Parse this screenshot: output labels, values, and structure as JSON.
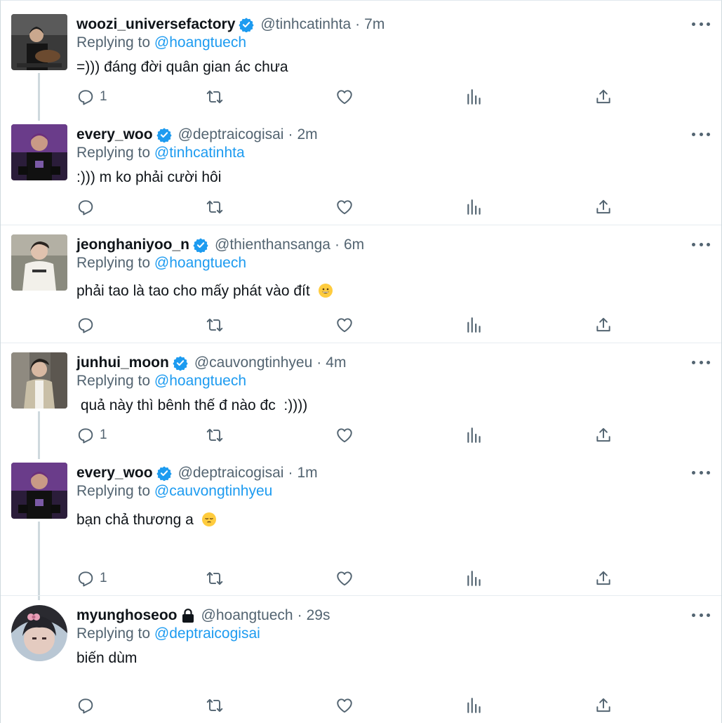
{
  "replying_label": "Replying to",
  "colors": {
    "accent": "#1d9bf0",
    "muted": "#536471",
    "text": "#0f1419",
    "verified": "#1d9bf0"
  },
  "icons": {
    "reply": "reply-icon",
    "retweet": "retweet-icon",
    "like": "heart-icon",
    "views": "analytics-icon",
    "share": "share-icon",
    "more": "more-icon",
    "verified": "verified-badge-icon",
    "lock": "lock-icon"
  },
  "tweets": [
    {
      "name": "woozi_universefactory",
      "verified": true,
      "handle": "@tinhcatinhta",
      "sep": "·",
      "time": "7m",
      "reply_to": "@hoangtuech",
      "text": "=))) đáng đời quân gian ác chưa",
      "reply_count": "1"
    },
    {
      "name": "every_woo",
      "verified": true,
      "handle": "@deptraicogisai",
      "sep": "·",
      "time": "2m",
      "reply_to": "@tinhcatinhta",
      "text": ":))) m ko phải cười hôi",
      "reply_count": ""
    },
    {
      "name": "jeonghaniyoo_n",
      "verified": true,
      "handle": "@thienthansanga",
      "sep": "·",
      "time": "6m",
      "reply_to": "@hoangtuech",
      "text": "phải tao là tao cho mấy phát vào đít",
      "emoji": "grinning-face",
      "reply_count": ""
    },
    {
      "name": "junhui_moon",
      "verified": true,
      "handle": "@cauvongtinhyeu",
      "sep": "·",
      "time": "4m",
      "reply_to": "@hoangtuech",
      "text": " quả này thì bênh thế đ nào đc  :))))",
      "reply_count": "1"
    },
    {
      "name": "every_woo",
      "verified": true,
      "handle": "@deptraicogisai",
      "sep": "·",
      "time": "1m",
      "reply_to": "@cauvongtinhyeu",
      "text": "bạn chả thương a",
      "emoji": "pensive-face",
      "reply_count": "1"
    },
    {
      "name": "myunghoseoo",
      "verified": false,
      "locked": true,
      "handle": "@hoangtuech",
      "sep": "·",
      "time": "29s",
      "reply_to": "@deptraicogisai",
      "text": "biến dùm",
      "reply_count": ""
    }
  ]
}
